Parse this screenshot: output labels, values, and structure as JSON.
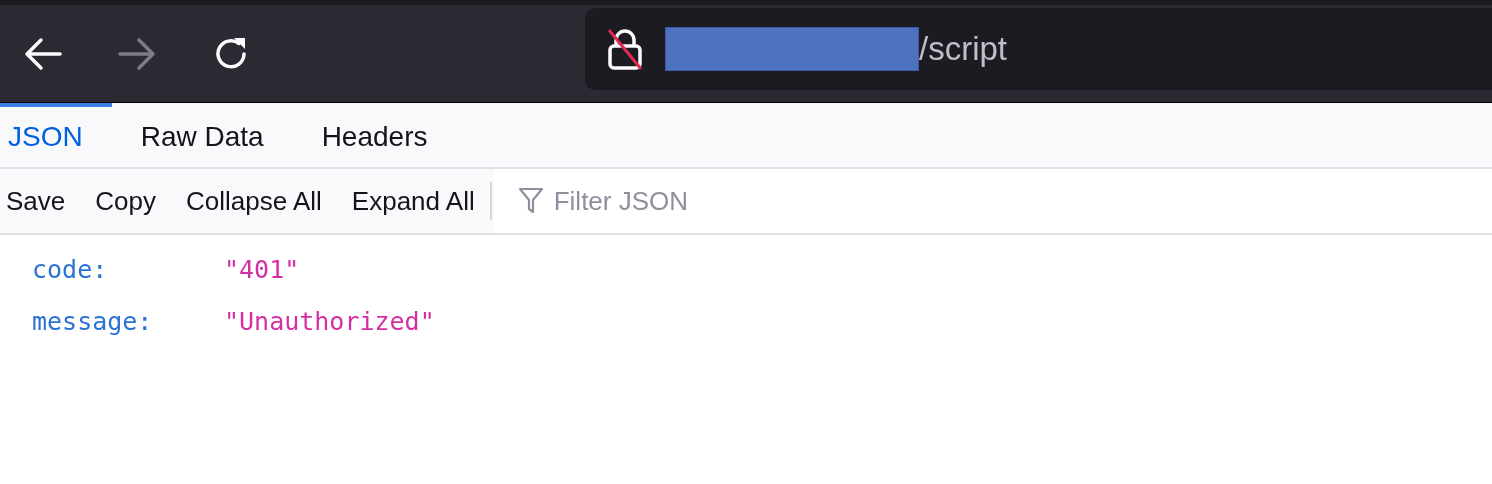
{
  "nav": {
    "back_disabled": false,
    "forward_disabled": true
  },
  "url_bar": {
    "insecure": true,
    "redacted": true,
    "path": "/script"
  },
  "tabs": [
    {
      "label": "JSON",
      "selected": true
    },
    {
      "label": "Raw Data",
      "selected": false
    },
    {
      "label": "Headers",
      "selected": false
    }
  ],
  "toolbar": {
    "buttons": [
      "Save",
      "Copy",
      "Collapse All",
      "Expand All"
    ],
    "filter": {
      "placeholder": "Filter JSON"
    }
  },
  "rows": [
    {
      "key": "code:",
      "value": "\"401\""
    },
    {
      "key": "message:",
      "value": "\"Unauthorized\""
    }
  ]
}
